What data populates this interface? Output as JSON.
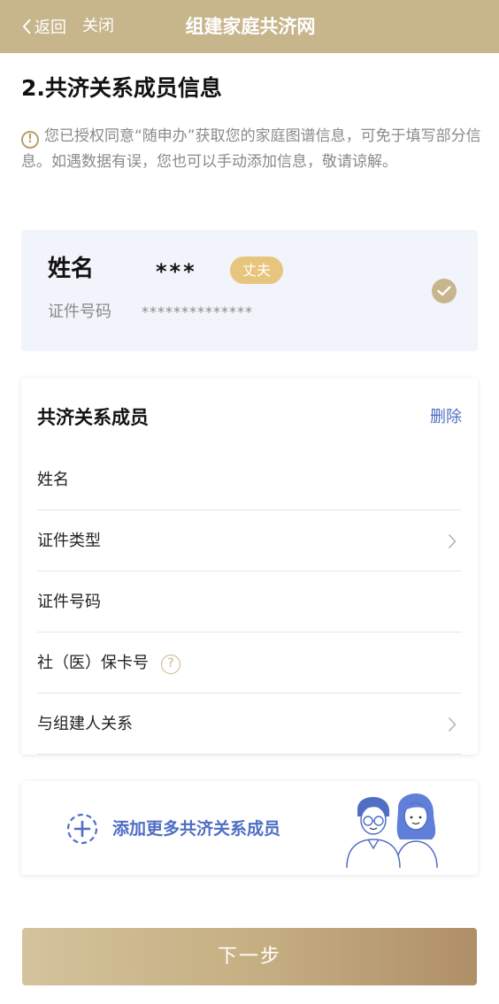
{
  "nav": {
    "back_label": "返回",
    "close_label": "关闭",
    "title": "组建家庭共济网"
  },
  "section": {
    "title": "2.共济关系成员信息"
  },
  "notice": {
    "text": "您已授权同意“随申办”获取您的家庭图谱信息，可免于填写部分信息。如遇数据有误，您也可以手动添加信息，敬请谅解。"
  },
  "member": {
    "name_label": "姓名",
    "name_value": "***",
    "relation_badge": "丈夫",
    "id_label": "证件号码",
    "id_value": "**************",
    "selected": true
  },
  "form": {
    "title": "共济关系成员",
    "delete_label": "删除",
    "fields": [
      {
        "label": "姓名",
        "value": ""
      },
      {
        "label": "证件类型",
        "value": ""
      },
      {
        "label": "证件号码",
        "value": ""
      },
      {
        "label": "社（医）保卡号",
        "value": ""
      },
      {
        "label": "与组建人关系",
        "value": ""
      }
    ]
  },
  "add_member": {
    "label": "添加更多共济关系成员"
  },
  "next_button": {
    "label": "下一步"
  },
  "colors": {
    "nav_bg": "#c7b58c",
    "accent_gold": "#c7b58c",
    "link_blue": "#4f6ec4",
    "badge_orange": "#e8c57e",
    "card_bg": "#f2f4fb"
  },
  "icons": {
    "back": "chevron-left-icon",
    "notice": "exclamation-circle-icon",
    "check": "check-circle-icon",
    "chevron": "chevron-right-icon",
    "help": "question-circle-icon",
    "add": "plus-dashed-circle-icon",
    "illustration": "family-couple-illustration"
  }
}
